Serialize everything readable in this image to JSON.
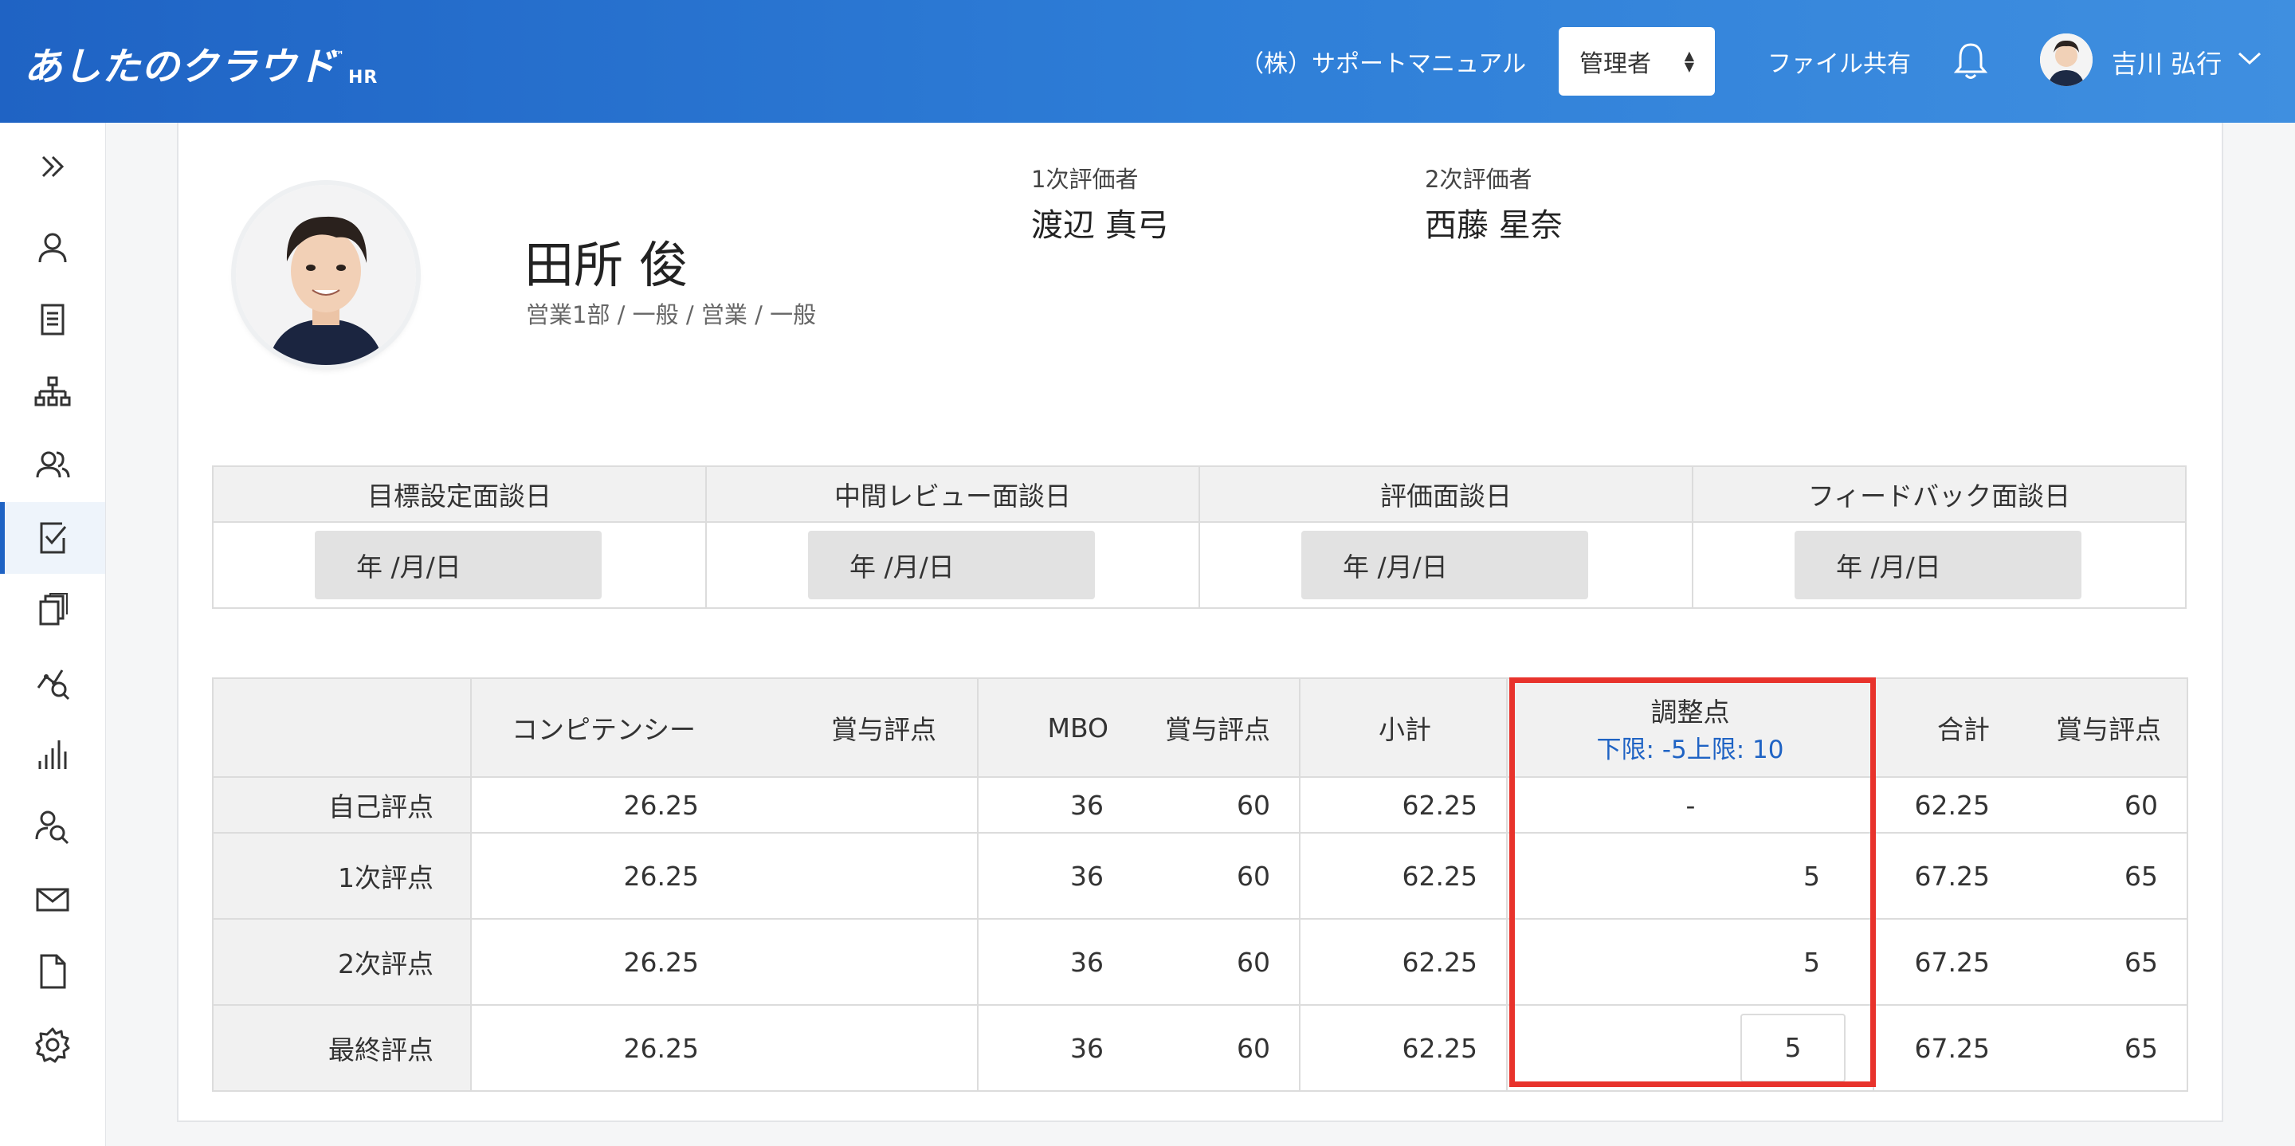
{
  "header": {
    "logo": "あしたのクラウド",
    "logo_tm": "™",
    "logo_sub": "HR",
    "company": "（株）サポートマニュアル",
    "role_selected": "管理者",
    "file_share": "ファイル共有",
    "user_name": "吉川 弘行"
  },
  "sidebar": {
    "items": [
      {
        "icon": "double-chevron-right-icon"
      },
      {
        "icon": "person-icon"
      },
      {
        "icon": "document-icon"
      },
      {
        "icon": "org-chart-icon"
      },
      {
        "icon": "people-icon"
      },
      {
        "icon": "checklist-icon",
        "active": true
      },
      {
        "icon": "copy-icon"
      },
      {
        "icon": "analytics-search-icon"
      },
      {
        "icon": "bar-chart-icon"
      },
      {
        "icon": "person-search-icon"
      },
      {
        "icon": "mail-icon"
      },
      {
        "icon": "file-icon"
      },
      {
        "icon": "gear-icon"
      }
    ]
  },
  "employee": {
    "name": "田所 俊",
    "dept": "営業1部 / 一般 / 営業 / 一般"
  },
  "evaluators": {
    "first_label": "1次評価者",
    "first_name": "渡辺 真弓",
    "second_label": "2次評価者",
    "second_name": "西藤 星奈"
  },
  "interviews": {
    "headers": [
      "目標設定面談日",
      "中間レビュー面談日",
      "評価面談日",
      "フィードバック面談日"
    ],
    "date_placeholder": "年 /月/日"
  },
  "scores": {
    "headers": {
      "competency": "コンピテンシー",
      "bonus1": "賞与評点",
      "mbo": "MBO",
      "bonus2": "賞与評点",
      "subtotal": "小計",
      "adjust": "調整点",
      "adjust_limit": "下限: -5上限: 10",
      "total": "合計",
      "bonus3": "賞与評点"
    },
    "rows": [
      {
        "label": "自己評点",
        "competency": "26.25",
        "mbo": "36",
        "mbo_bonus": "60",
        "subtotal": "62.25",
        "adjust": "-",
        "total": "62.25",
        "total_bonus": "60"
      },
      {
        "label": "1次評点",
        "competency": "26.25",
        "mbo": "36",
        "mbo_bonus": "60",
        "subtotal": "62.25",
        "adjust": "5",
        "total": "67.25",
        "total_bonus": "65"
      },
      {
        "label": "2次評点",
        "competency": "26.25",
        "mbo": "36",
        "mbo_bonus": "60",
        "subtotal": "62.25",
        "adjust": "5",
        "total": "67.25",
        "total_bonus": "65"
      },
      {
        "label": "最終評点",
        "competency": "26.25",
        "mbo": "36",
        "mbo_bonus": "60",
        "subtotal": "62.25",
        "adjust": "5",
        "total": "67.25",
        "total_bonus": "65"
      }
    ]
  },
  "colors": {
    "header": "#1f63c4",
    "accent": "#1f63c4",
    "highlight": "#e8332c"
  }
}
